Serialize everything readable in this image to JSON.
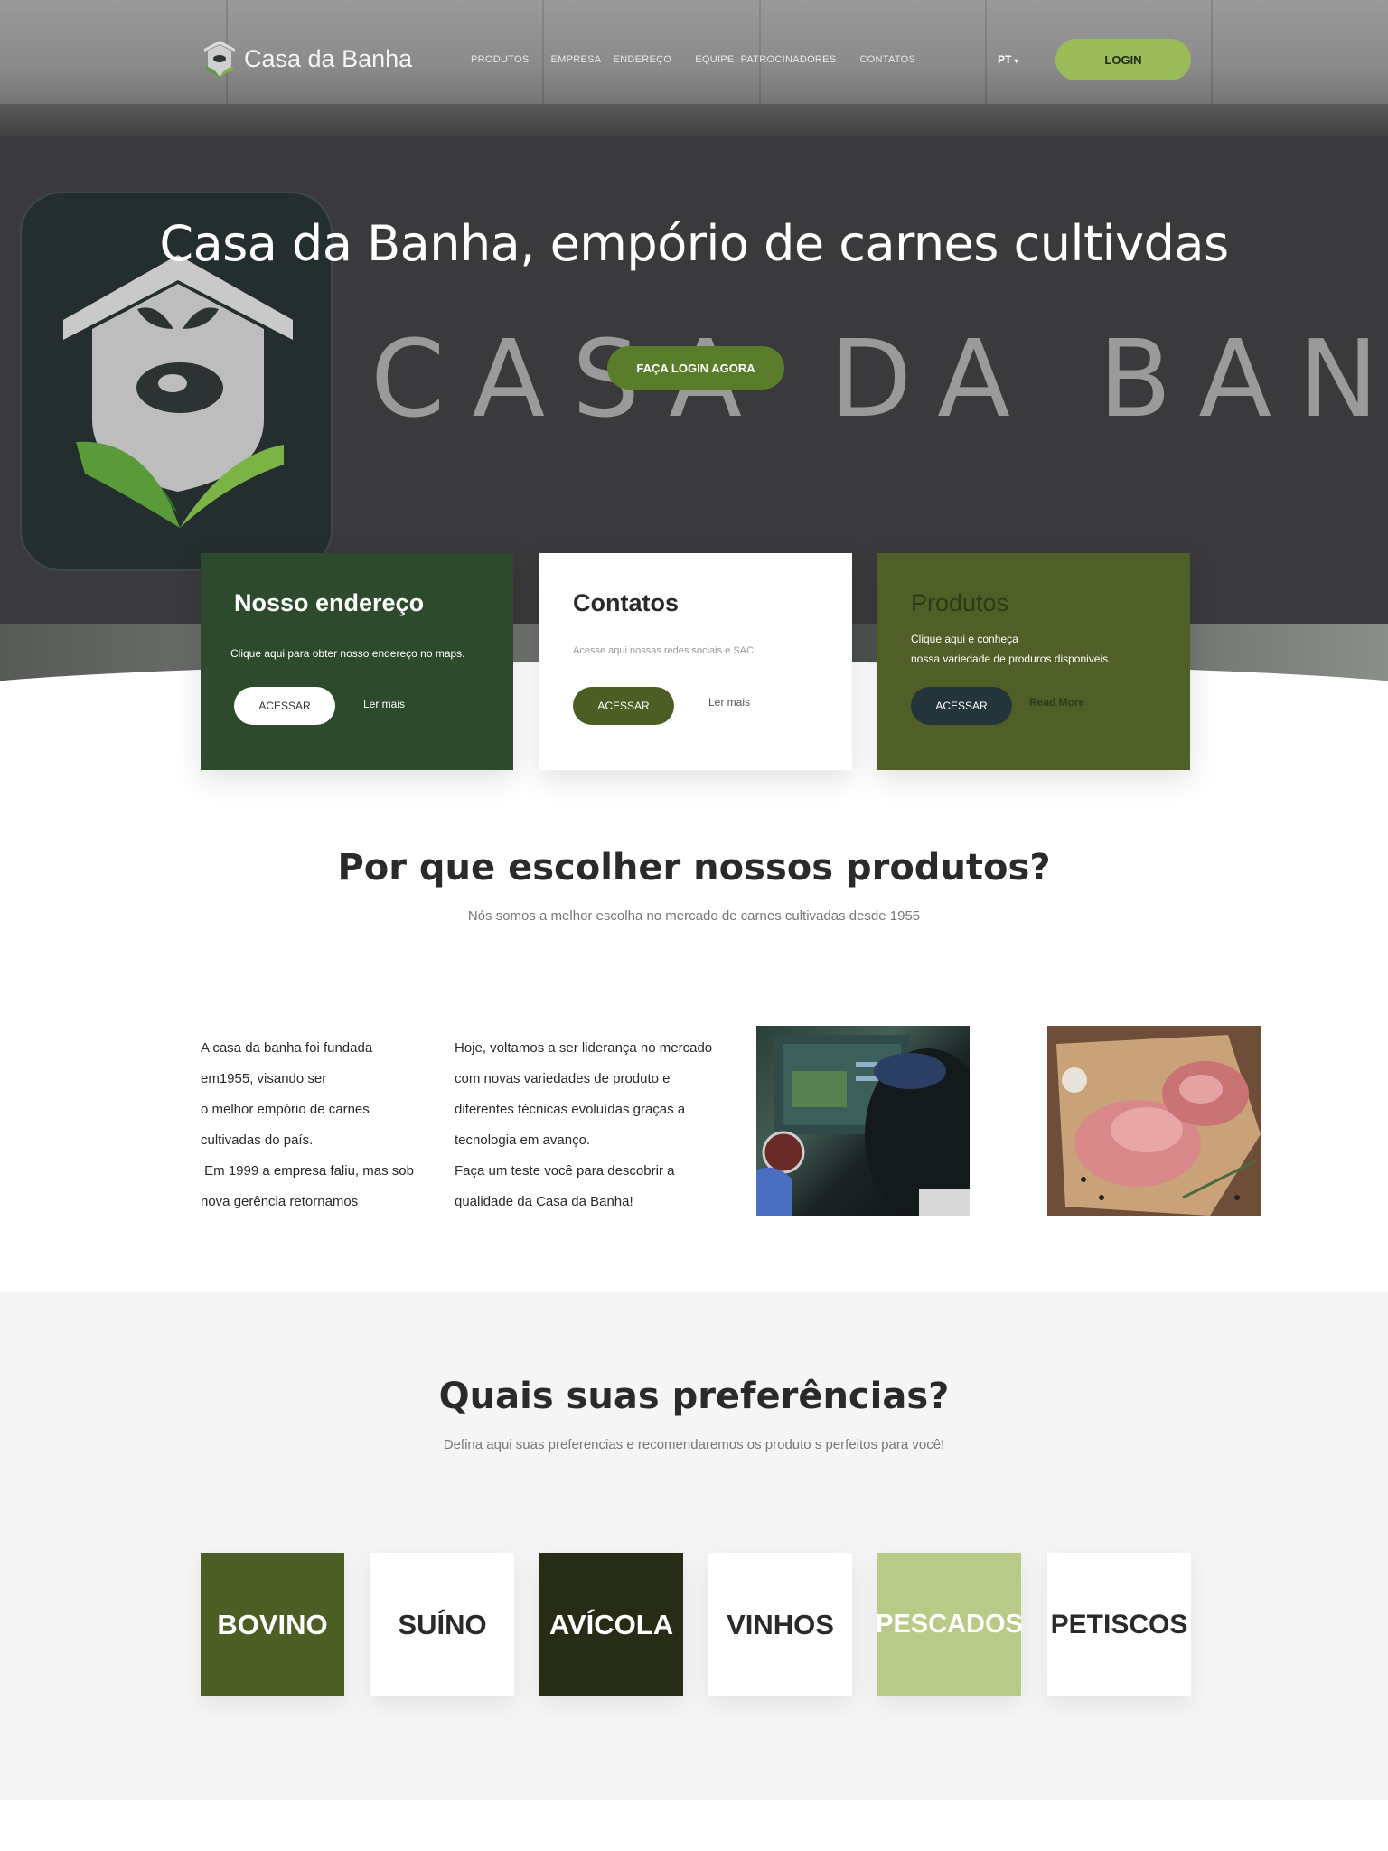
{
  "nav": {
    "logo_text": "Casa da Banha",
    "menu": [
      "PRODUTOS",
      "EMPRESA",
      "ENDEREÇO",
      "EQUIPE",
      "PATROCINADORES",
      "CONTATOS"
    ],
    "language": "PT",
    "login_label": "LOGIN"
  },
  "hero": {
    "title": "Casa da Banha, empório de carnes  cultivdas",
    "cta_label": "FAÇA LOGIN AGORA",
    "sign_text": "CASA DA BANHA"
  },
  "cards": [
    {
      "title": "Nosso endereço",
      "description": "Clique aqui para obter nosso endereço no maps.",
      "button_label": "ACESSAR",
      "more_label": "Ler mais"
    },
    {
      "title": "Contatos",
      "description": "Acesse aqui nossas redes sociais e SAC",
      "button_label": "ACESSAR",
      "more_label": "Ler mais"
    },
    {
      "title": "Produtos",
      "description": "Clique aqui e conheça\nnossa variedade de produros disponiveis.",
      "button_label": "ACESSAR",
      "more_label": "Read More"
    }
  ],
  "why": {
    "title": "Por que escolher nossos produtos?",
    "subtitle": "Nós somos a melhor escolha no mercado de carnes cultivadas desde 1955",
    "col1": "A casa da banha foi fundada\nem1955, visando ser\no melhor empório de carnes\ncultivadas do país.\n Em 1999 a empresa faliu, mas sob\nnova gerência retornamos",
    "col2": "Hoje, voltamos a ser liderança no mercado\ncom novas variedades de produto e\ndiferentes técnicas evoluídas graças a\ntecnologia em avanço.\nFaça um teste você para descobrir a\nqualidade da Casa da Banha!"
  },
  "preferences": {
    "title": "Quais suas preferências?",
    "subtitle": "Defina aqui suas preferencias e recomendaremos os produto s perfeitos para você!",
    "tiles": [
      {
        "label": "BOVINO",
        "bg": "#4c5e23",
        "color": "#ffffff"
      },
      {
        "label": "SUÍNO",
        "bg": "#ffffff",
        "color": "#2a2a2a"
      },
      {
        "label": "AVÍCOLA",
        "bg": "#262c15",
        "color": "#ffffff"
      },
      {
        "label": "VINHOS",
        "bg": "#ffffff",
        "color": "#2a2a2a"
      },
      {
        "label": "PESCADOS",
        "bg": "#b8ca88",
        "color": "#ffffff"
      },
      {
        "label": "PETISCOS",
        "bg": "#ffffff",
        "color": "#2a2a2a"
      }
    ]
  },
  "colors": {
    "accent_green": "#9bbb59",
    "dark_green": "#2d4a2d",
    "olive": "#505f28"
  }
}
